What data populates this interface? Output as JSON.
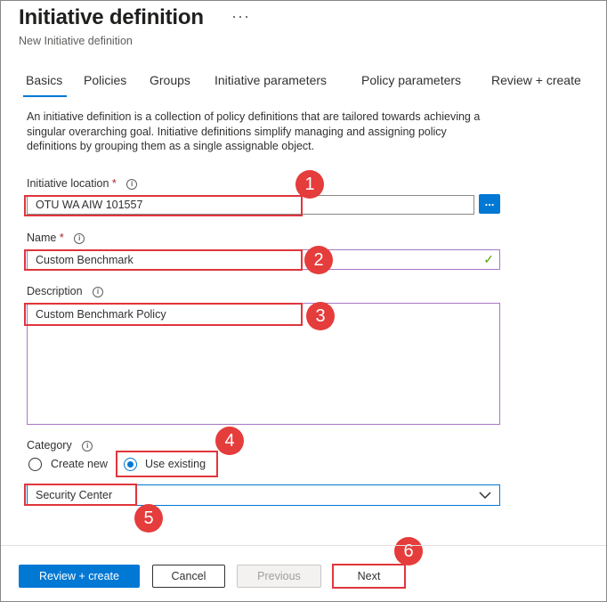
{
  "header": {
    "title": "Initiative definition",
    "more_label": "···",
    "subtitle": "New Initiative definition"
  },
  "tabs": [
    {
      "label": "Basics"
    },
    {
      "label": "Policies"
    },
    {
      "label": "Groups"
    },
    {
      "label": "Initiative parameters"
    },
    {
      "label": "Policy parameters"
    },
    {
      "label": "Review + create"
    }
  ],
  "description": "An initiative definition is a collection of policy definitions that are tailored towards achieving a singular overarching goal. Initiative definitions simplify managing and assigning policy definitions by grouping them as a single assignable object.",
  "form": {
    "location": {
      "label": "Initiative location",
      "required": "*",
      "value": "OTU WA AIW 101557",
      "browse_label": "..."
    },
    "name": {
      "label": "Name",
      "required": "*",
      "value": "Custom Benchmark",
      "valid_mark": "✓"
    },
    "description": {
      "label": "Description",
      "value": "Custom Benchmark Policy"
    },
    "category": {
      "label": "Category",
      "options": [
        {
          "label": "Create new",
          "selected": false
        },
        {
          "label": "Use existing",
          "selected": true
        }
      ],
      "value": "Security Center"
    }
  },
  "info_glyph": "i",
  "annotations": [
    "1",
    "2",
    "3",
    "4",
    "5",
    "6"
  ],
  "footer": {
    "review_create": "Review + create",
    "cancel": "Cancel",
    "previous": "Previous",
    "next": "Next"
  },
  "colors": {
    "accent": "#0078d4",
    "highlight": "#e0353c",
    "badge": "#e53c3c",
    "focus_border": "#a877c4",
    "valid": "#57a300"
  }
}
